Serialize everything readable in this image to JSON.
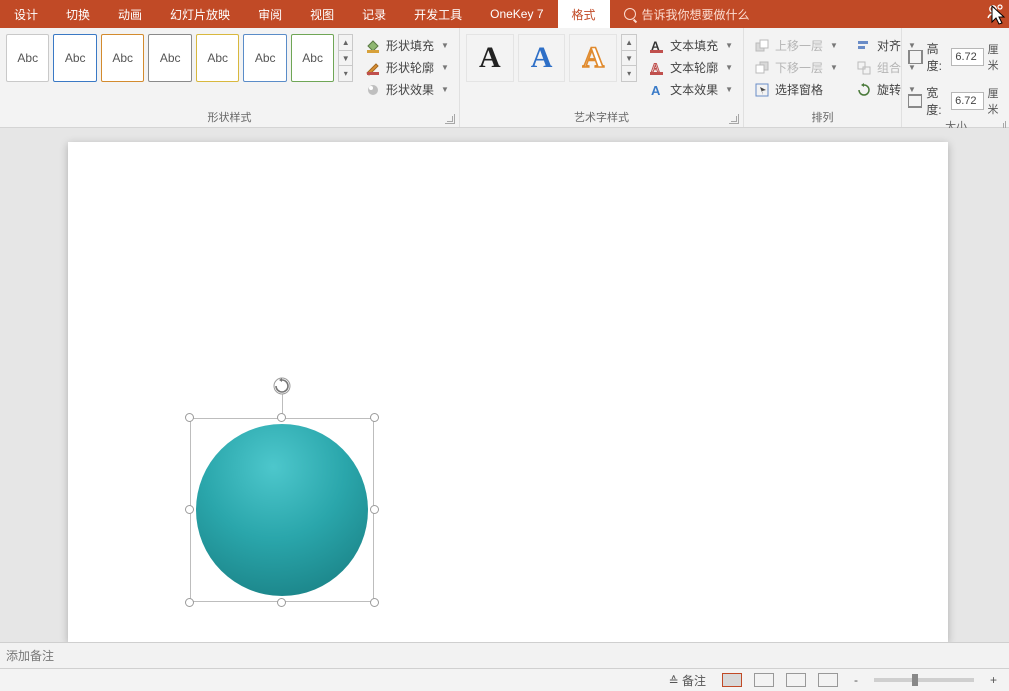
{
  "tabs": {
    "design": "设计",
    "transition": "切换",
    "animation": "动画",
    "slideshow": "幻灯片放映",
    "review": "审阅",
    "view": "视图",
    "record": "记录",
    "developer": "开发工具",
    "onekey": "OneKey 7",
    "format": "格式"
  },
  "tellme": "告诉我你想要做什么",
  "groups": {
    "shape_styles": "形状样式",
    "wordart_styles": "艺术字样式",
    "arrange": "排列",
    "size": "大小"
  },
  "style_thumb_text": "Abc",
  "shape_cmds": {
    "fill": "形状填充",
    "outline": "形状轮廓",
    "effects": "形状效果"
  },
  "text_cmds": {
    "fill": "文本填充",
    "outline": "文本轮廓",
    "effects": "文本效果"
  },
  "arrange_cmds": {
    "bring_forward": "上移一层",
    "send_backward": "下移一层",
    "selection_pane": "选择窗格",
    "align": "对齐",
    "group": "组合",
    "rotate": "旋转"
  },
  "size": {
    "height_label": "高度:",
    "width_label": "宽度:",
    "height_value": "6.72",
    "width_value": "6.72",
    "unit": "厘米"
  },
  "notes_placeholder": "添加备注",
  "status": {
    "notes_btn": "备注",
    "zoom_out": "-",
    "zoom_in": "+"
  },
  "wa_glyph": "A"
}
